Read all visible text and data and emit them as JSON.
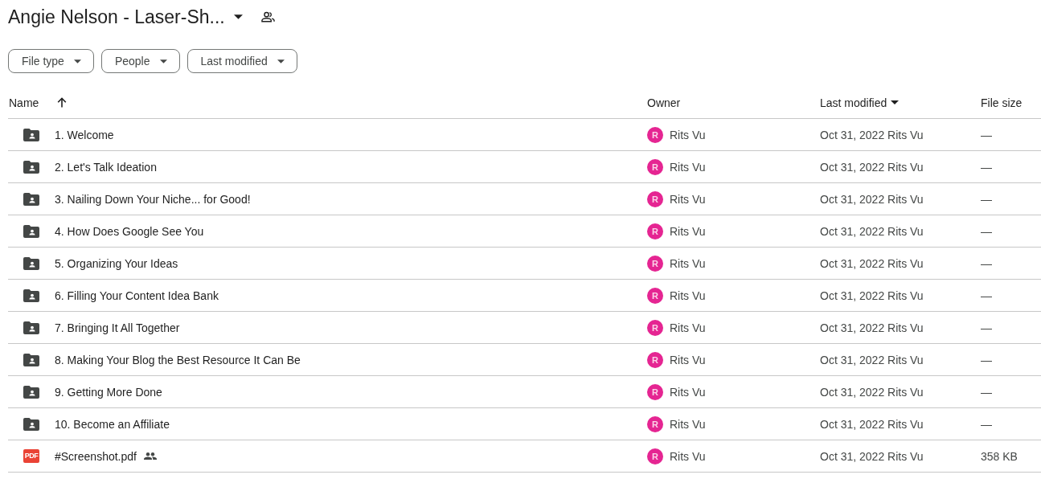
{
  "header": {
    "title": "Angie Nelson - Laser-Sh..."
  },
  "filters": [
    {
      "label": "File type"
    },
    {
      "label": "People"
    },
    {
      "label": "Last modified"
    }
  ],
  "table": {
    "columns": [
      {
        "label": "Name",
        "sorted": true,
        "menu": false
      },
      {
        "label": "Owner",
        "sorted": false,
        "menu": false
      },
      {
        "label": "Last modified",
        "sorted": false,
        "menu": true
      },
      {
        "label": "File size",
        "sorted": false,
        "menu": false
      }
    ],
    "rows": [
      {
        "kind": "folder",
        "name": "1. Welcome",
        "shared": false,
        "owner_initial": "R",
        "owner": "Rits Vu",
        "modified": "Oct 31, 2022 Rits Vu",
        "size": "—"
      },
      {
        "kind": "folder",
        "name": "2. Let's Talk Ideation",
        "shared": false,
        "owner_initial": "R",
        "owner": "Rits Vu",
        "modified": "Oct 31, 2022 Rits Vu",
        "size": "—"
      },
      {
        "kind": "folder",
        "name": "3. Nailing Down Your Niche... for Good!",
        "shared": false,
        "owner_initial": "R",
        "owner": "Rits Vu",
        "modified": "Oct 31, 2022 Rits Vu",
        "size": "—"
      },
      {
        "kind": "folder",
        "name": "4. How Does Google See You",
        "shared": false,
        "owner_initial": "R",
        "owner": "Rits Vu",
        "modified": "Oct 31, 2022 Rits Vu",
        "size": "—"
      },
      {
        "kind": "folder",
        "name": "5. Organizing Your Ideas",
        "shared": false,
        "owner_initial": "R",
        "owner": "Rits Vu",
        "modified": "Oct 31, 2022 Rits Vu",
        "size": "—"
      },
      {
        "kind": "folder",
        "name": "6. Filling Your Content Idea Bank",
        "shared": false,
        "owner_initial": "R",
        "owner": "Rits Vu",
        "modified": "Oct 31, 2022 Rits Vu",
        "size": "—"
      },
      {
        "kind": "folder",
        "name": "7. Bringing It All Together",
        "shared": false,
        "owner_initial": "R",
        "owner": "Rits Vu",
        "modified": "Oct 31, 2022 Rits Vu",
        "size": "—"
      },
      {
        "kind": "folder",
        "name": "8. Making Your Blog the Best Resource It Can Be",
        "shared": false,
        "owner_initial": "R",
        "owner": "Rits Vu",
        "modified": "Oct 31, 2022 Rits Vu",
        "size": "—"
      },
      {
        "kind": "folder",
        "name": "9. Getting More Done",
        "shared": false,
        "owner_initial": "R",
        "owner": "Rits Vu",
        "modified": "Oct 31, 2022 Rits Vu",
        "size": "—"
      },
      {
        "kind": "folder",
        "name": "10. Become an Affiliate",
        "shared": false,
        "owner_initial": "R",
        "owner": "Rits Vu",
        "modified": "Oct 31, 2022 Rits Vu",
        "size": "—"
      },
      {
        "kind": "pdf",
        "badge": "PDF",
        "name": "#Screenshot.pdf",
        "shared": true,
        "owner_initial": "R",
        "owner": "Rits Vu",
        "modified": "Oct 31, 2022 Rits Vu",
        "size": "358 KB"
      }
    ]
  }
}
